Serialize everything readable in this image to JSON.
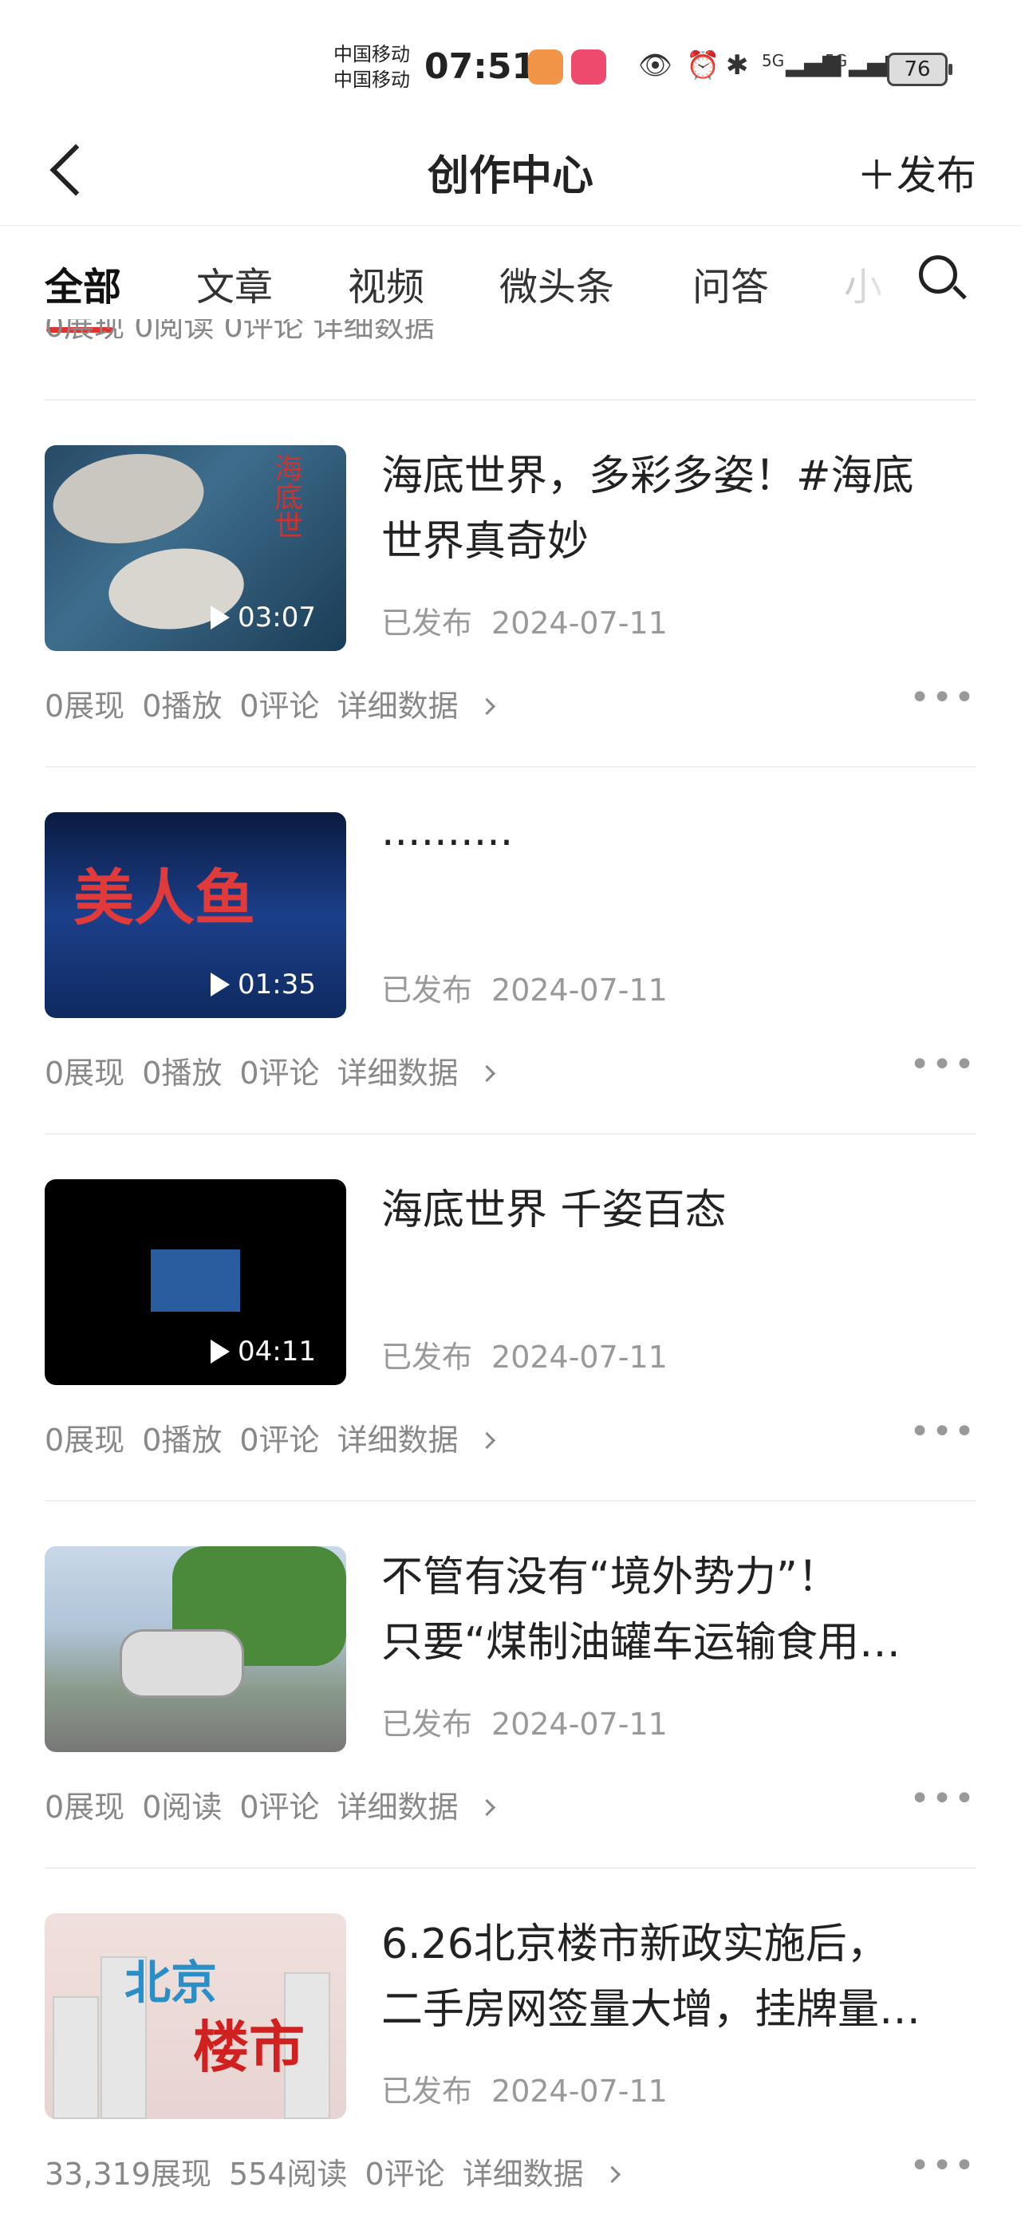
{
  "status_bar": {
    "carrier1": "中国移动",
    "carrier2": "中国移动",
    "time": "07:51",
    "network1": "5G",
    "network2": "5G",
    "battery": "76"
  },
  "header": {
    "title": "创作中心",
    "publish_label": "发布"
  },
  "tabs": [
    "全部",
    "文章",
    "视频",
    "微头条",
    "问答",
    "小"
  ],
  "partial_stats": "0展现 0阅读 0评论 详细数据",
  "items": [
    {
      "thumb_text": "海底世",
      "duration": "03:07",
      "title_line1": "海底世界，多彩多姿！#海底",
      "title_line2": "世界真奇妙",
      "status": "已发布",
      "date": "2024-07-11",
      "impressions": "0展现",
      "views": "0播放",
      "comments": "0评论",
      "detail": "详细数据"
    },
    {
      "thumb_text": "美人鱼",
      "duration": "01:35",
      "title_line1": "··········",
      "title_line2": "",
      "status": "已发布",
      "date": "2024-07-11",
      "impressions": "0展现",
      "views": "0播放",
      "comments": "0评论",
      "detail": "详细数据"
    },
    {
      "duration": "04:11",
      "title_line1": "海底世界 千姿百态",
      "title_line2": "",
      "status": "已发布",
      "date": "2024-07-11",
      "impressions": "0展现",
      "views": "0播放",
      "comments": "0评论",
      "detail": "详细数据"
    },
    {
      "title_line1": "不管有没有“境外势力”！",
      "title_line2": "只要“煤制油罐车运输食用…",
      "status": "已发布",
      "date": "2024-07-11",
      "impressions": "0展现",
      "views": "0阅读",
      "comments": "0评论",
      "detail": "详细数据"
    },
    {
      "thumb_text1": "北京",
      "thumb_text2": "楼市",
      "title_line1": "6.26北京楼市新政实施后，",
      "title_line2": "二手房网签量大增，挂牌量…",
      "status": "已发布",
      "date": "2024-07-11",
      "impressions": "33,319展现",
      "views": "554阅读",
      "comments": "0评论",
      "detail": "详细数据"
    }
  ]
}
